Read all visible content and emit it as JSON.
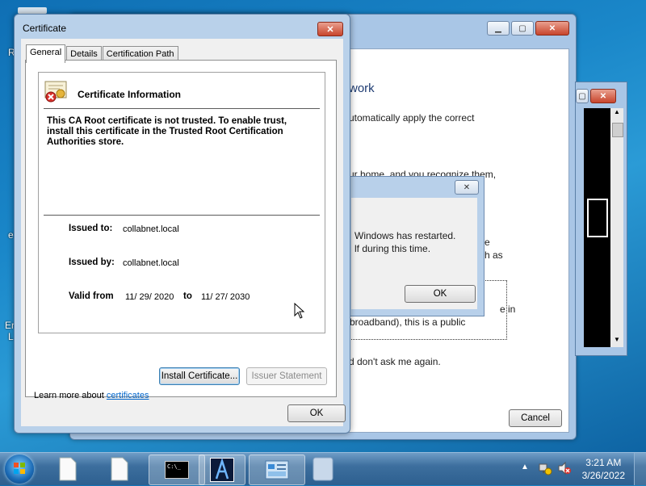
{
  "desktop": {
    "glyphs": [
      "R",
      "e",
      "Er",
      "L"
    ]
  },
  "bg_window": {
    "heading_fragment": "work",
    "line1": "utomatically apply the correct",
    "line2": "ur home, and you recognize them,",
    "line3": "e",
    "line4": "h as",
    "line5": "e in",
    "line6": "broadband), this is a public",
    "line7": "d don't ask me again.",
    "cancel_label": "Cancel"
  },
  "small_dialog": {
    "line1": "Windows has restarted.",
    "line2": "lf during this time.",
    "ok_label": "OK"
  },
  "cert_window": {
    "title": "Certificate",
    "close_glyph": "✕",
    "tabs": [
      {
        "label": "General",
        "active": true
      },
      {
        "label": "Details",
        "active": false
      },
      {
        "label": "Certification Path",
        "active": false
      }
    ],
    "info_title": "Certificate Information",
    "warning": "This CA Root certificate is not trusted. To enable trust, install this certificate in the Trusted Root Certification Authorities store.",
    "issued_to_label": "Issued to:",
    "issued_to": "collabnet.local",
    "issued_by_label": "Issued by:",
    "issued_by": "collabnet.local",
    "valid_from_label": "Valid from",
    "valid_from": "11/ 29/ 2020",
    "valid_to_label": "to",
    "valid_to": "11/ 27/ 2030",
    "install_label": "Install Certificate...",
    "issuer_statement_label": "Issuer Statement",
    "learn_more_prefix": "Learn more about",
    "learn_more_link": "certificates",
    "ok_label": "OK"
  },
  "taskbar": {
    "clock_time": "3:21 AM",
    "clock_date": "3/26/2022"
  }
}
